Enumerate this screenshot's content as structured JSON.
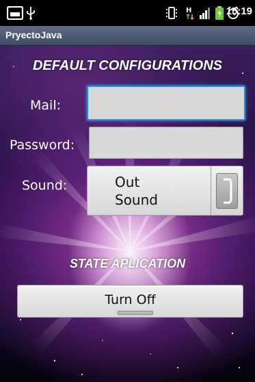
{
  "status_bar": {
    "time": "15:19",
    "icons": [
      "sim-card-icon",
      "usb-icon",
      "vibrate-icon",
      "data-transfer-icon",
      "signal-icon",
      "battery-icon",
      "alarm-icon"
    ]
  },
  "app": {
    "title": "PryectoJava"
  },
  "config": {
    "heading": "DEFAULT CONFIGURATIONS",
    "mail_label": "Mail:",
    "mail_value": "",
    "password_label": "Password:",
    "password_value": "",
    "sound_label": "Sound:",
    "sound_button_label": "Out Sound"
  },
  "state": {
    "heading": "STATE APLICATION",
    "toggle_label": "Turn Off"
  },
  "colors": {
    "focus_border": "#1e8ee8",
    "title_bar": "#4e5a72"
  }
}
